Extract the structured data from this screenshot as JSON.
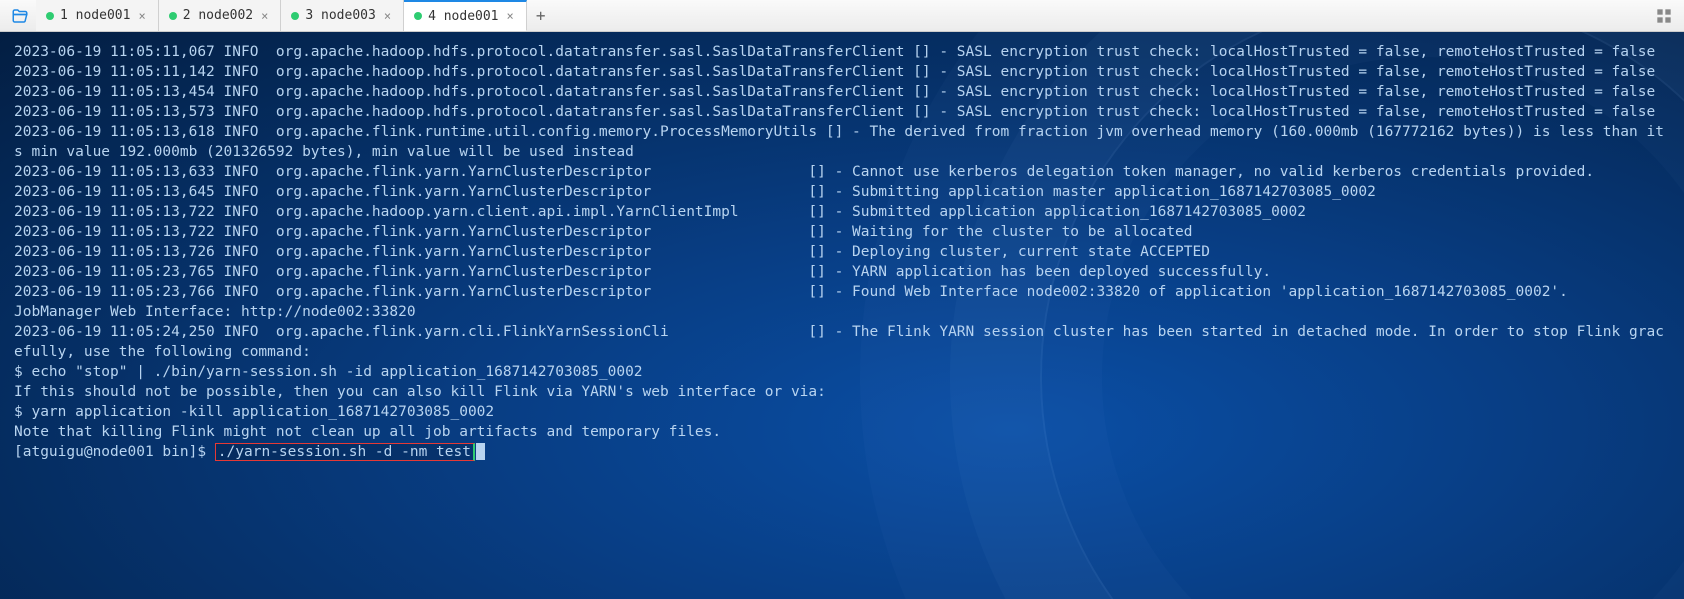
{
  "tabs": [
    {
      "label": "1 node001",
      "active": false
    },
    {
      "label": "2 node002",
      "active": false
    },
    {
      "label": "3 node003",
      "active": false
    },
    {
      "label": "4 node001",
      "active": true
    }
  ],
  "log": {
    "lines": [
      "2023-06-19 11:05:11,067 INFO  org.apache.hadoop.hdfs.protocol.datatransfer.sasl.SaslDataTransferClient [] - SASL encryption trust check: localHostTrusted = false, remoteHostTrusted = false",
      "2023-06-19 11:05:11,142 INFO  org.apache.hadoop.hdfs.protocol.datatransfer.sasl.SaslDataTransferClient [] - SASL encryption trust check: localHostTrusted = false, remoteHostTrusted = false",
      "2023-06-19 11:05:13,454 INFO  org.apache.hadoop.hdfs.protocol.datatransfer.sasl.SaslDataTransferClient [] - SASL encryption trust check: localHostTrusted = false, remoteHostTrusted = false",
      "2023-06-19 11:05:13,573 INFO  org.apache.hadoop.hdfs.protocol.datatransfer.sasl.SaslDataTransferClient [] - SASL encryption trust check: localHostTrusted = false, remoteHostTrusted = false",
      "2023-06-19 11:05:13,618 INFO  org.apache.flink.runtime.util.config.memory.ProcessMemoryUtils [] - The derived from fraction jvm overhead memory (160.000mb (167772162 bytes)) is less than its min value 192.000mb (201326592 bytes), min value will be used instead",
      "2023-06-19 11:05:13,633 INFO  org.apache.flink.yarn.YarnClusterDescriptor                  [] - Cannot use kerberos delegation token manager, no valid kerberos credentials provided.",
      "2023-06-19 11:05:13,645 INFO  org.apache.flink.yarn.YarnClusterDescriptor                  [] - Submitting application master application_1687142703085_0002",
      "2023-06-19 11:05:13,722 INFO  org.apache.hadoop.yarn.client.api.impl.YarnClientImpl        [] - Submitted application application_1687142703085_0002",
      "2023-06-19 11:05:13,722 INFO  org.apache.flink.yarn.YarnClusterDescriptor                  [] - Waiting for the cluster to be allocated",
      "2023-06-19 11:05:13,726 INFO  org.apache.flink.yarn.YarnClusterDescriptor                  [] - Deploying cluster, current state ACCEPTED",
      "2023-06-19 11:05:23,765 INFO  org.apache.flink.yarn.YarnClusterDescriptor                  [] - YARN application has been deployed successfully.",
      "2023-06-19 11:05:23,766 INFO  org.apache.flink.yarn.YarnClusterDescriptor                  [] - Found Web Interface node002:33820 of application 'application_1687142703085_0002'.",
      "JobManager Web Interface: http://node002:33820",
      "2023-06-19 11:05:24,250 INFO  org.apache.flink.yarn.cli.FlinkYarnSessionCli                [] - The Flink YARN session cluster has been started in detached mode. In order to stop Flink gracefully, use the following command:",
      "$ echo \"stop\" | ./bin/yarn-session.sh -id application_1687142703085_0002",
      "If this should not be possible, then you can also kill Flink via YARN's web interface or via:",
      "$ yarn application -kill application_1687142703085_0002",
      "Note that killing Flink might not clean up all job artifacts and temporary files."
    ]
  },
  "prompt": {
    "prefix": "[atguigu@node001 bin]$ ",
    "command": "./yarn-session.sh -d -nm test"
  }
}
